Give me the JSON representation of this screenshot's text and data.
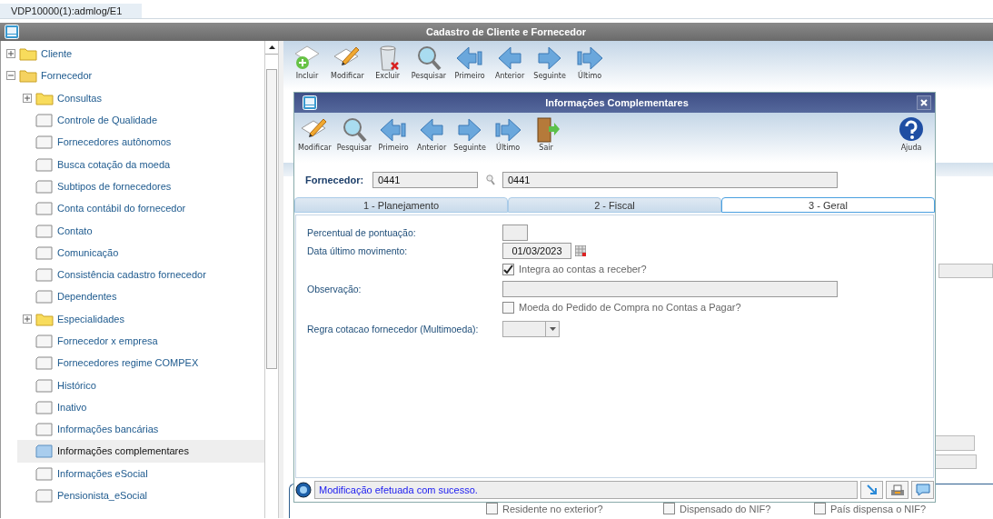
{
  "tab_strip": {
    "tab": "VDP10000(1):admlog/E1"
  },
  "main_window": {
    "title": "Cadastro de Cliente e Fornecedor",
    "toolbar": [
      {
        "kind": "add",
        "label": "Incluir"
      },
      {
        "kind": "edit",
        "label": "Modificar"
      },
      {
        "kind": "delete",
        "label": "Excluir"
      },
      {
        "kind": "search",
        "label": "Pesquisar"
      },
      {
        "kind": "first",
        "label": "Primeiro"
      },
      {
        "kind": "previous",
        "label": "Anterior"
      },
      {
        "kind": "next",
        "label": "Seguinte"
      },
      {
        "kind": "last",
        "label": "Último"
      }
    ],
    "checkboxes": [
      {
        "label": "Residente no exterior?",
        "checked": false
      },
      {
        "label": "Dispensado do NIF?",
        "checked": false
      },
      {
        "label": "País dispensa o NIF?",
        "checked": false
      }
    ]
  },
  "tree": [
    {
      "kind": "folder",
      "label": "Cliente",
      "expanded": false,
      "selected": false
    },
    {
      "kind": "folder",
      "label": "Fornecedor",
      "expanded": true,
      "selected": false,
      "children": [
        {
          "kind": "folder",
          "label": "Consultas",
          "expanded": false,
          "selected": false
        },
        {
          "kind": "page",
          "label": "Controle de Qualidade",
          "selected": false
        },
        {
          "kind": "page",
          "label": "Fornecedores autônomos",
          "selected": false
        },
        {
          "kind": "page",
          "label": "Busca cotação da moeda",
          "selected": false
        },
        {
          "kind": "page",
          "label": "Subtipos de fornecedores",
          "selected": false
        },
        {
          "kind": "page",
          "label": "Conta contábil do fornecedor",
          "selected": false
        },
        {
          "kind": "page",
          "label": "Contato",
          "selected": false
        },
        {
          "kind": "page",
          "label": "Comunicação",
          "selected": false
        },
        {
          "kind": "page",
          "label": "Consistência cadastro fornecedor",
          "selected": false
        },
        {
          "kind": "page",
          "label": "Dependentes",
          "selected": false
        },
        {
          "kind": "folder",
          "label": "Especialidades",
          "expanded": false,
          "selected": false
        },
        {
          "kind": "page",
          "label": "Fornecedor x empresa",
          "selected": false
        },
        {
          "kind": "page",
          "label": "Fornecedores regime COMPEX",
          "selected": false
        },
        {
          "kind": "page",
          "label": "Histórico",
          "selected": false
        },
        {
          "kind": "page",
          "label": "Inativo",
          "selected": false
        },
        {
          "kind": "page",
          "label": "Informações bancárias",
          "selected": false
        },
        {
          "kind": "page",
          "label": "Informações complementares",
          "selected": true
        },
        {
          "kind": "page",
          "label": "Informações eSocial",
          "selected": false
        },
        {
          "kind": "page",
          "label": "Pensionista_eSocial",
          "selected": false
        }
      ]
    }
  ],
  "dialog": {
    "title": "Informações Complementares",
    "toolbar": [
      {
        "kind": "edit",
        "label": "Modificar"
      },
      {
        "kind": "search",
        "label": "Pesquisar"
      },
      {
        "kind": "first",
        "label": "Primeiro"
      },
      {
        "kind": "previous",
        "label": "Anterior"
      },
      {
        "kind": "next",
        "label": "Seguinte"
      },
      {
        "kind": "last",
        "label": "Último"
      },
      {
        "kind": "exit",
        "label": "Sair"
      }
    ],
    "help": {
      "label": "Ajuda"
    },
    "fornecedor": {
      "label": "Fornecedor:",
      "code": "0441",
      "name": "0441"
    },
    "tabs": [
      {
        "label": "1 - Planejamento",
        "selected": false
      },
      {
        "label": "2 - Fiscal",
        "selected": false
      },
      {
        "label": "3 - Geral",
        "selected": true
      }
    ],
    "form": [
      {
        "kind": "field",
        "label": "Percentual de pontuação:"
      },
      {
        "kind": "date",
        "label": "Data último movimento:",
        "value": "01/03/2023"
      },
      {
        "kind": "checkbox",
        "label": "Integra ao contas a receber?",
        "checked": true
      },
      {
        "kind": "wide",
        "label": "Observação:"
      },
      {
        "kind": "checkbox",
        "label": "Moeda do Pedido de Compra no Contas a Pagar?",
        "checked": false
      },
      {
        "kind": "select",
        "label": "Regra cotacao fornecedor (Multimoeda):"
      }
    ],
    "status": {
      "message": "Modificação efetuada com sucesso."
    }
  }
}
